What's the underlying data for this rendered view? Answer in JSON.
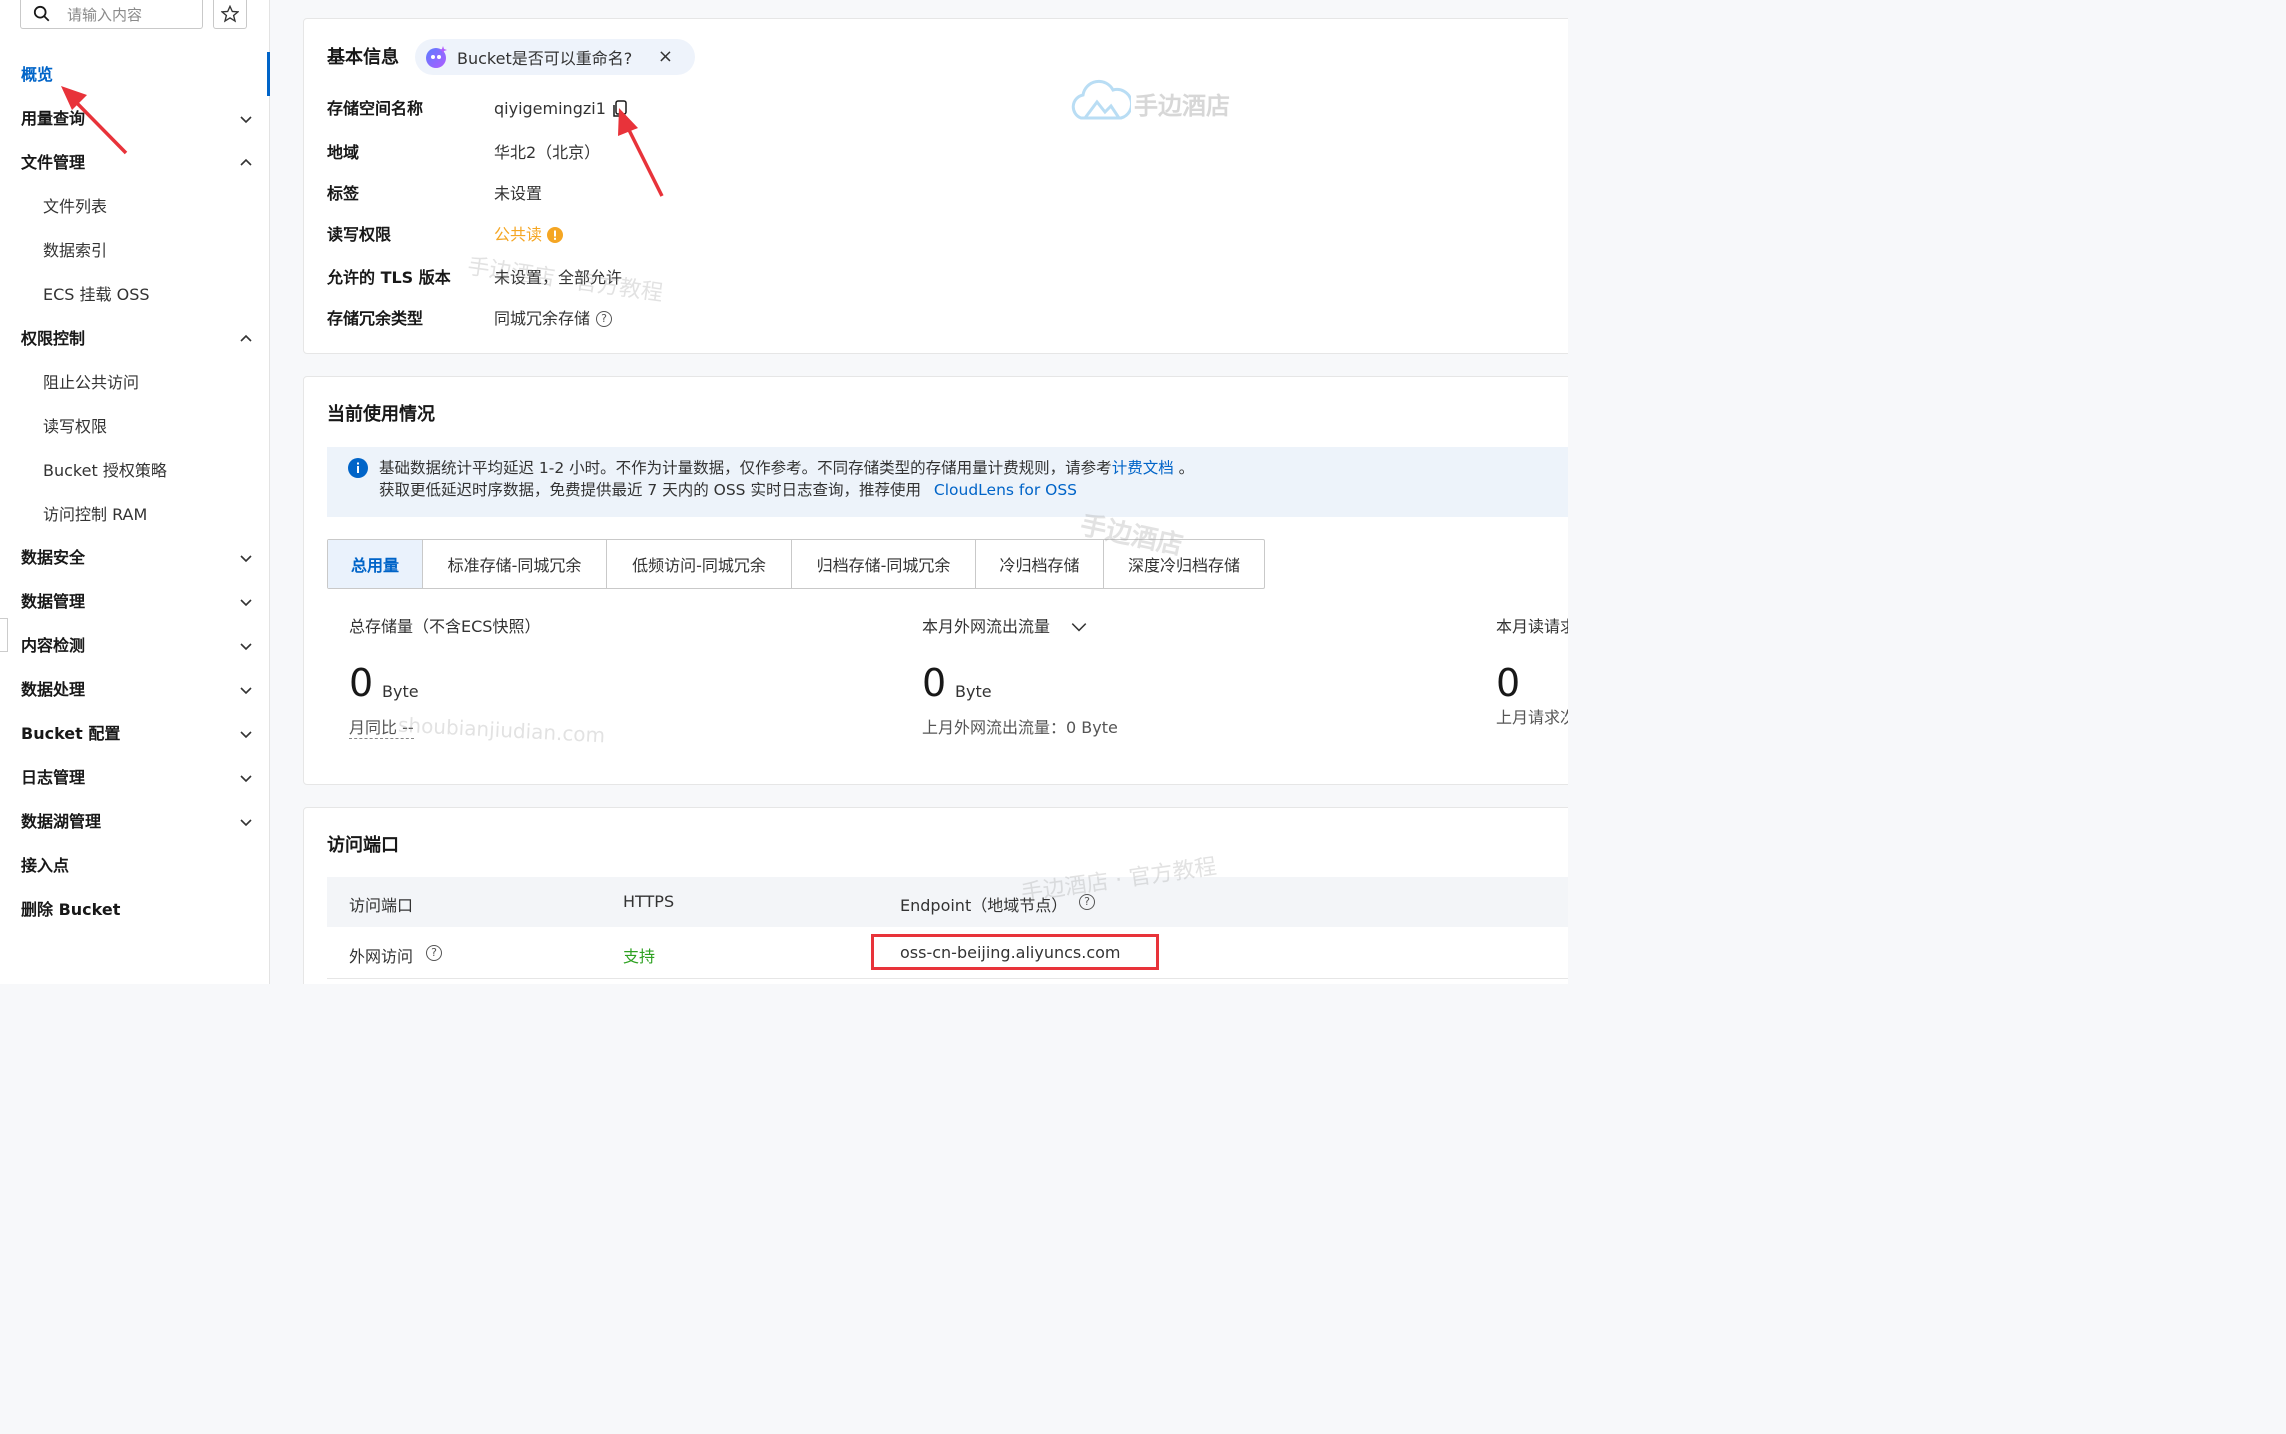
{
  "search": {
    "placeholder": "请输入内容"
  },
  "sidebar": {
    "items": [
      {
        "label": "概览"
      },
      {
        "label": "用量查询"
      },
      {
        "label": "文件管理"
      },
      {
        "label": "文件列表"
      },
      {
        "label": "数据索引"
      },
      {
        "label": "ECS 挂载 OSS"
      },
      {
        "label": "权限控制"
      },
      {
        "label": "阻止公共访问"
      },
      {
        "label": "读写权限"
      },
      {
        "label": "Bucket 授权策略"
      },
      {
        "label": "访问控制 RAM"
      },
      {
        "label": "数据安全"
      },
      {
        "label": "数据管理"
      },
      {
        "label": "内容检测"
      },
      {
        "label": "数据处理"
      },
      {
        "label": "Bucket 配置"
      },
      {
        "label": "日志管理"
      },
      {
        "label": "数据湖管理"
      },
      {
        "label": "接入点"
      },
      {
        "label": "删除 Bucket"
      }
    ]
  },
  "basic": {
    "title": "基本信息",
    "tip": "Bucket是否可以重命名?",
    "close": "×",
    "rows": [
      {
        "label": "存储空间名称",
        "value": "qiyigemingzi1"
      },
      {
        "label": "地域",
        "value": "华北2（北京）"
      },
      {
        "label": "标签",
        "value": "未设置"
      },
      {
        "label": "读写权限",
        "value": "公共读"
      },
      {
        "label": "允许的 TLS 版本",
        "value": "未设置，全部允许"
      },
      {
        "label": "存储冗余类型",
        "value": "同城冗余存储"
      }
    ]
  },
  "usage": {
    "title": "当前使用情况",
    "notice_line1": "基础数据统计平均延迟 1-2 小时。不作为计量数据，仅作参考。不同存储类型的存储用量计费规则，请参考",
    "notice_link1": "计费文档",
    "notice_end1": " 。",
    "notice_line2": "获取更低延迟时序数据，免费提供最近 7 天内的 OSS 实时日志查询，推荐使用",
    "notice_link2": "CloudLens for OSS",
    "tabs": [
      "总用量",
      "标准存储-同城冗余",
      "低频访问-同城冗余",
      "归档存储-同城冗余",
      "冷归档存储",
      "深度冷归档存储"
    ],
    "stats": [
      {
        "label": "总存储量（不含ECS快照）",
        "value": "0",
        "unit": "Byte",
        "sub": "月同比 --"
      },
      {
        "label": "本月外网流出流量",
        "value": "0",
        "unit": "Byte",
        "sub": "上月外网流出流量：0 Byte"
      },
      {
        "label": "本月读请求",
        "value": "0",
        "unit": "",
        "sub": "上月请求次"
      }
    ]
  },
  "access": {
    "title": "访问端口",
    "headers": [
      "访问端口",
      "HTTPS",
      "Endpoint（地域节点）"
    ],
    "row": {
      "port": "外网访问",
      "https": "支持",
      "endpoint": "oss-cn-beijing.aliyuncs.com"
    }
  },
  "watermarks": {
    "logo": "手边酒店",
    "w1": "手边酒店 · 官方教程",
    "w2": "shoubianjiudian.com",
    "w3": "手边酒店"
  },
  "colors": {
    "accent": "#0064c8",
    "warning": "#f5a623",
    "success": "#2ea121",
    "highlight": "#e8333a"
  }
}
